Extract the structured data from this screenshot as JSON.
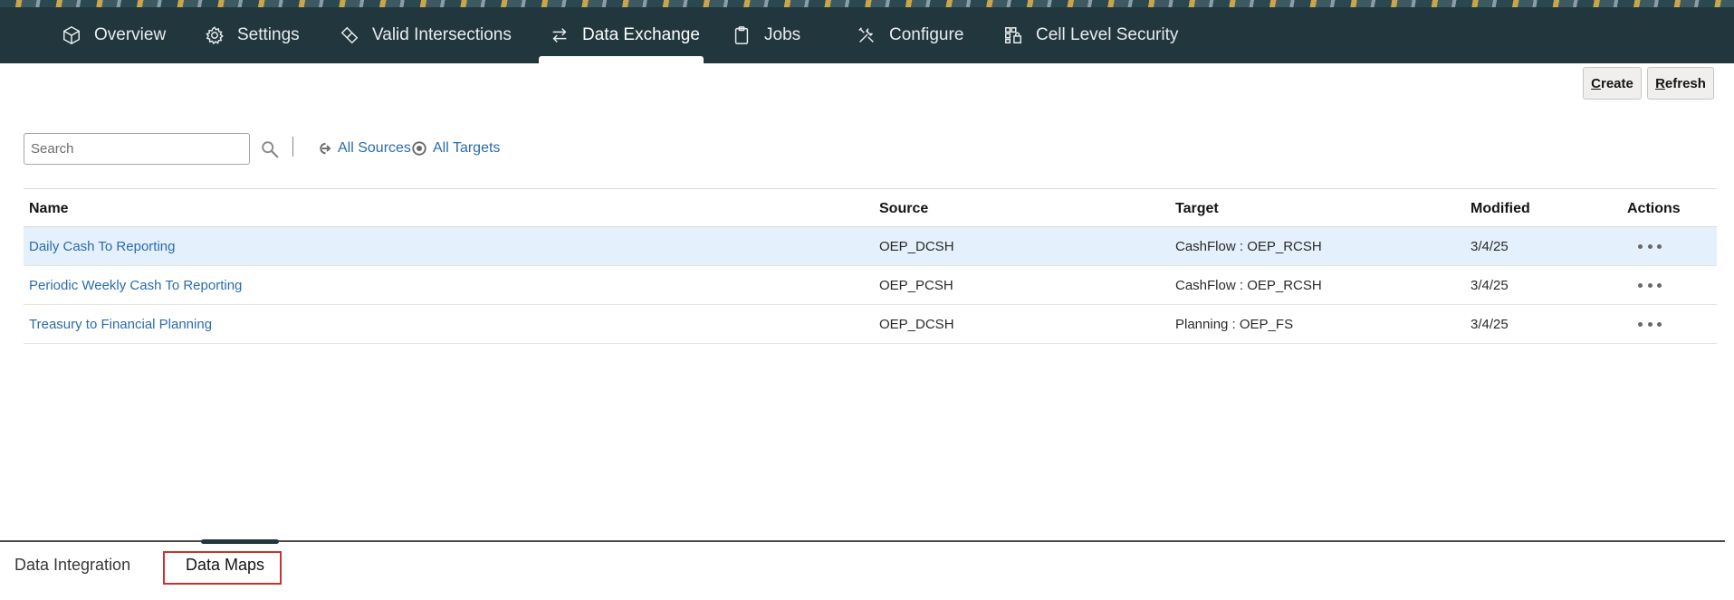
{
  "nav": {
    "tabs": [
      {
        "label": "Overview",
        "icon": "cube-icon"
      },
      {
        "label": "Settings",
        "icon": "gear-icon"
      },
      {
        "label": "Valid Intersections",
        "icon": "intersections-icon"
      },
      {
        "label": "Data Exchange",
        "icon": "exchange-arrows-icon",
        "active": true
      },
      {
        "label": "Jobs",
        "icon": "clipboard-icon"
      },
      {
        "label": "Configure",
        "icon": "tools-icon"
      },
      {
        "label": "Cell Level Security",
        "icon": "cell-security-icon"
      }
    ]
  },
  "toolbar": {
    "create_first": "C",
    "create_rest": "reate",
    "refresh_first": "R",
    "refresh_rest": "efresh"
  },
  "search": {
    "placeholder": "Search"
  },
  "filters": {
    "sources": "All Sources",
    "targets": "All Targets"
  },
  "table": {
    "headers": {
      "name": "Name",
      "source": "Source",
      "target": "Target",
      "modified": "Modified",
      "actions": "Actions"
    },
    "rows": [
      {
        "name": "Daily Cash To Reporting",
        "source": "OEP_DCSH",
        "target": "CashFlow : OEP_RCSH",
        "modified": "3/4/25"
      },
      {
        "name": "Periodic Weekly Cash To Reporting",
        "source": "OEP_PCSH",
        "target": "CashFlow : OEP_RCSH",
        "modified": "3/4/25"
      },
      {
        "name": "Treasury to Financial Planning",
        "source": "OEP_DCSH",
        "target": "Planning : OEP_FS",
        "modified": "3/4/25"
      }
    ]
  },
  "bottom_tabs": {
    "integration": "Data Integration",
    "maps": "Data Maps"
  },
  "colors": {
    "nav_bg": "#22373d",
    "link": "#2a6bb0",
    "selected_row": "#e4f0fb",
    "highlight": "#c5352b"
  }
}
